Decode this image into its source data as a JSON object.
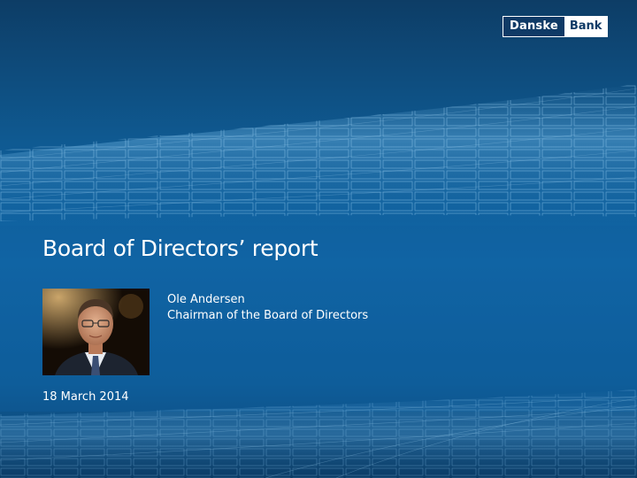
{
  "logo": {
    "part1": "Danske",
    "part2": "Bank"
  },
  "title": "Board of Directors’ report",
  "presenter": {
    "name": "Ole Andersen",
    "role": "Chairman of the Board of Directors"
  },
  "date": "18 March 2014",
  "colors": {
    "background": "#1167a8",
    "background_dark": "#0d3d66",
    "brand_dark": "#0f3a66",
    "text": "#ffffff"
  }
}
